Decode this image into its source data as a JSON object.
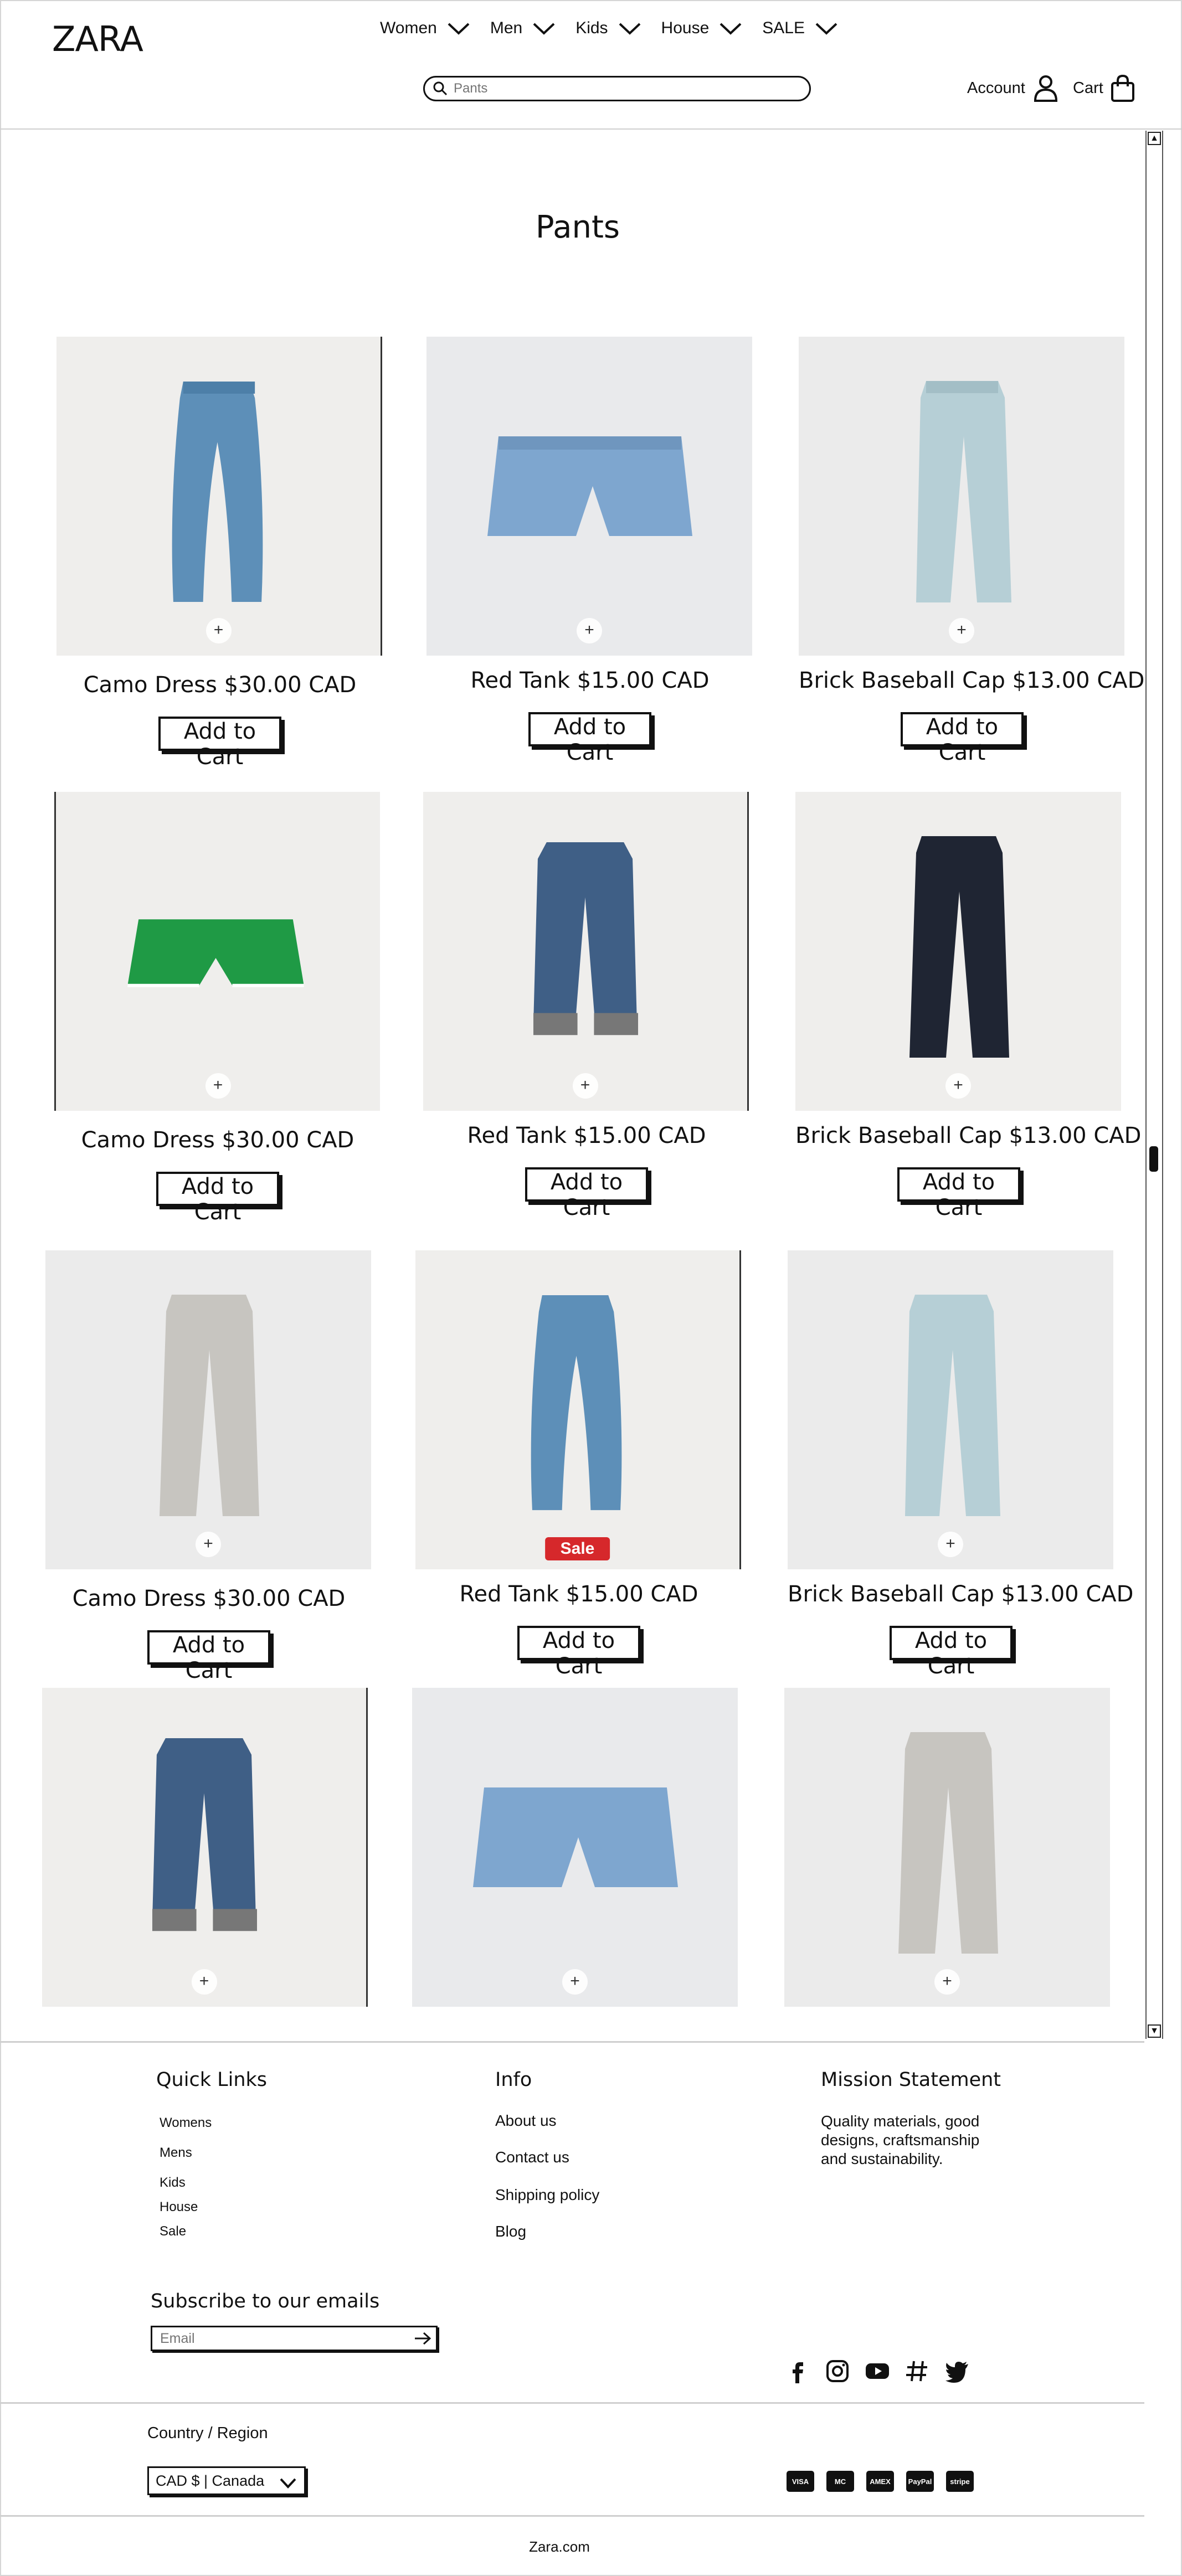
{
  "header": {
    "logo": "ZARA",
    "nav": [
      {
        "label": "Women"
      },
      {
        "label": "Men"
      },
      {
        "label": "Kids"
      },
      {
        "label": "House"
      },
      {
        "label": "SALE"
      }
    ],
    "search_placeholder": "Pants",
    "account_label": "Account",
    "cart_label": "Cart"
  },
  "main": {
    "title": "Pants",
    "add_label": "Add to Cart",
    "products": [
      {
        "caption": "Camo Dress $30.00 CAD",
        "image": "wide-leg-barrel-jeans-medium-blue"
      },
      {
        "caption": "Red Tank $15.00 CAD",
        "image": "light-blue-denim-shorts"
      },
      {
        "caption": "Brick Baseball Cap $13.00 CAD",
        "image": "pale-blue-wide-jeans"
      },
      {
        "caption": "Camo Dress $30.00 CAD",
        "image": "green-track-shorts"
      },
      {
        "caption": "Red Tank $15.00 CAD",
        "image": "dark-cuffed-denim-capris"
      },
      {
        "caption": "Brick Baseball Cap $13.00 CAD",
        "image": "black-wide-jeans"
      },
      {
        "caption": "Camo Dress $30.00 CAD",
        "image": "grey-wide-jeans"
      },
      {
        "caption": "Red Tank $15.00 CAD",
        "image": "barrel-jeans-medium-blue",
        "badge": "Sale"
      },
      {
        "caption": "Brick Baseball Cap $13.00 CAD",
        "image": "pale-blue-wide-jeans"
      },
      {
        "image": "dark-cuffed-denim-capris"
      },
      {
        "image": "light-blue-denim-shorts"
      },
      {
        "image": "grey-wide-jeans"
      }
    ]
  },
  "footer": {
    "quick_links_heading": "Quick Links",
    "quick_links": [
      "Womens",
      "Mens",
      "Kids",
      "House",
      "Sale"
    ],
    "info_heading": "Info",
    "info_links": [
      "About us",
      "Contact us",
      "Shipping policy",
      "Blog"
    ],
    "mission_heading": "Mission Statement",
    "mission_text": "Quality materials, good designs, craftsmanship and sustainability.",
    "subscribe_heading": "Subscribe to our emails",
    "email_placeholder": "Email",
    "socials": [
      "facebook-icon",
      "instagram-icon",
      "youtube-icon",
      "hashtag-icon",
      "twitter-icon"
    ],
    "country_label": "Country / Region",
    "country_value": "CAD $ | Canada",
    "payments": [
      "VISA",
      "MC",
      "AMEX",
      "PayPal",
      "stripe"
    ],
    "copyright": "Zara.com"
  },
  "colors": {
    "sale_badge": "#d6282b",
    "text": "#111111",
    "image_bg": "#ececec"
  }
}
